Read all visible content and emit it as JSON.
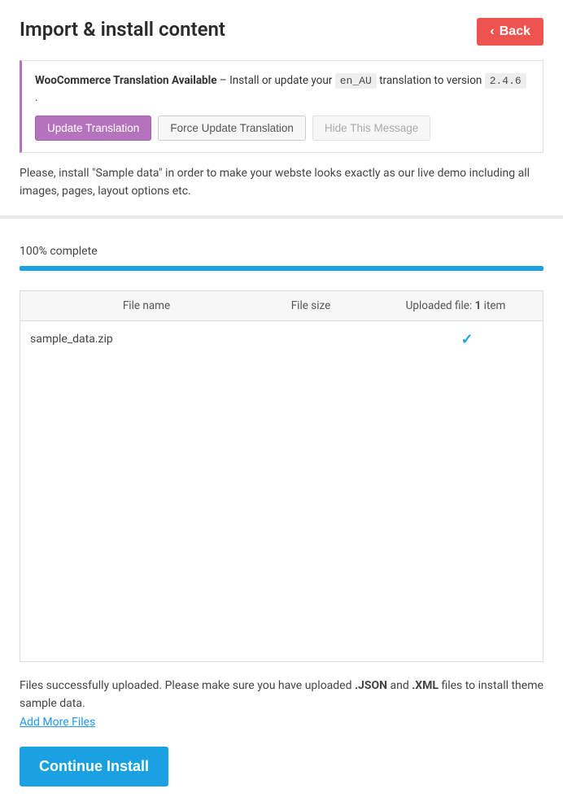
{
  "header": {
    "title": "Import & install content",
    "back_label": "Back"
  },
  "notice": {
    "strong_text": "WooCommerce Translation Available",
    "dash": " – ",
    "text_before_locale": "Install or update your ",
    "locale": "en_AU",
    "text_after_locale": " translation to version ",
    "version": "2.4.6",
    "period": " .",
    "btn_update": "Update Translation",
    "btn_force": "Force Update Translation",
    "btn_hide": "Hide This Message"
  },
  "intro": "Please, install \"Sample data\" in order to make your webste looks exactly as our live demo including all images, pages, layout options etc.",
  "progress": {
    "label": "100% complete",
    "percent": 100
  },
  "table": {
    "col_name": "File name",
    "col_size": "File size",
    "col_uploaded_prefix": "Uploaded file: ",
    "col_uploaded_count": "1",
    "col_uploaded_suffix": " item",
    "rows": [
      {
        "name": "sample_data.zip",
        "size": "",
        "uploaded": true
      }
    ]
  },
  "status": {
    "text_before_json": "Files successfully uploaded. Please make sure you have uploaded ",
    "json": ".JSON",
    "text_mid": " and ",
    "xml": ".XML",
    "text_after": " files to install theme sample data.",
    "add_more": "Add More Files"
  },
  "continue_label": "Continue Install"
}
